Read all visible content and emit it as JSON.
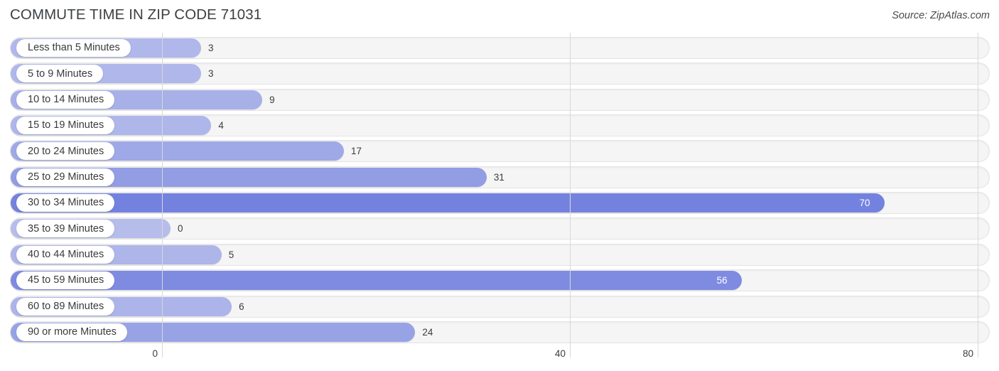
{
  "header": {
    "title": "COMMUTE TIME IN ZIP CODE 71031",
    "source": "Source: ZipAtlas.com"
  },
  "colors": {
    "bar_light": "#b6bdeb",
    "bar_dark": "#7986e0",
    "track": "#f5f5f5",
    "gridline": "#d8d8d8",
    "text": "#3c3c3c",
    "value_inside": "#ffffff"
  },
  "chart_data": {
    "type": "bar",
    "orientation": "horizontal",
    "title": "COMMUTE TIME IN ZIP CODE 71031",
    "subtitle": "",
    "xlabel": "",
    "ylabel": "",
    "xlim": [
      0,
      80
    ],
    "xticks": [
      0,
      40,
      80
    ],
    "xtick_labels": [
      "0",
      "40",
      "80"
    ],
    "grid": true,
    "legend": false,
    "source": "Source: ZipAtlas.com",
    "categories": [
      "Less than 5 Minutes",
      "5 to 9 Minutes",
      "10 to 14 Minutes",
      "15 to 19 Minutes",
      "20 to 24 Minutes",
      "25 to 29 Minutes",
      "30 to 34 Minutes",
      "35 to 39 Minutes",
      "40 to 44 Minutes",
      "45 to 59 Minutes",
      "60 to 89 Minutes",
      "90 or more Minutes"
    ],
    "values": [
      3,
      3,
      9,
      4,
      17,
      31,
      70,
      0,
      5,
      56,
      6,
      24
    ],
    "value_labels": [
      "3",
      "3",
      "9",
      "4",
      "17",
      "31",
      "70",
      "0",
      "5",
      "56",
      "6",
      "24"
    ]
  },
  "rows": [
    {
      "label": "Less than 5 Minutes",
      "value": 3,
      "value_label": "3",
      "label_inside": false
    },
    {
      "label": "5 to 9 Minutes",
      "value": 3,
      "value_label": "3",
      "label_inside": false
    },
    {
      "label": "10 to 14 Minutes",
      "value": 9,
      "value_label": "9",
      "label_inside": false
    },
    {
      "label": "15 to 19 Minutes",
      "value": 4,
      "value_label": "4",
      "label_inside": false
    },
    {
      "label": "20 to 24 Minutes",
      "value": 17,
      "value_label": "17",
      "label_inside": false
    },
    {
      "label": "25 to 29 Minutes",
      "value": 31,
      "value_label": "31",
      "label_inside": false
    },
    {
      "label": "30 to 34 Minutes",
      "value": 70,
      "value_label": "70",
      "label_inside": true
    },
    {
      "label": "35 to 39 Minutes",
      "value": 0,
      "value_label": "0",
      "label_inside": false
    },
    {
      "label": "40 to 44 Minutes",
      "value": 5,
      "value_label": "5",
      "label_inside": false
    },
    {
      "label": "45 to 59 Minutes",
      "value": 56,
      "value_label": "56",
      "label_inside": true
    },
    {
      "label": "60 to 89 Minutes",
      "value": 6,
      "value_label": "6",
      "label_inside": false
    },
    {
      "label": "90 or more Minutes",
      "value": 24,
      "value_label": "24",
      "label_inside": false
    }
  ],
  "axis": {
    "ticks": [
      {
        "label": "0",
        "value": 0
      },
      {
        "label": "40",
        "value": 40
      },
      {
        "label": "80",
        "value": 80
      }
    ]
  }
}
